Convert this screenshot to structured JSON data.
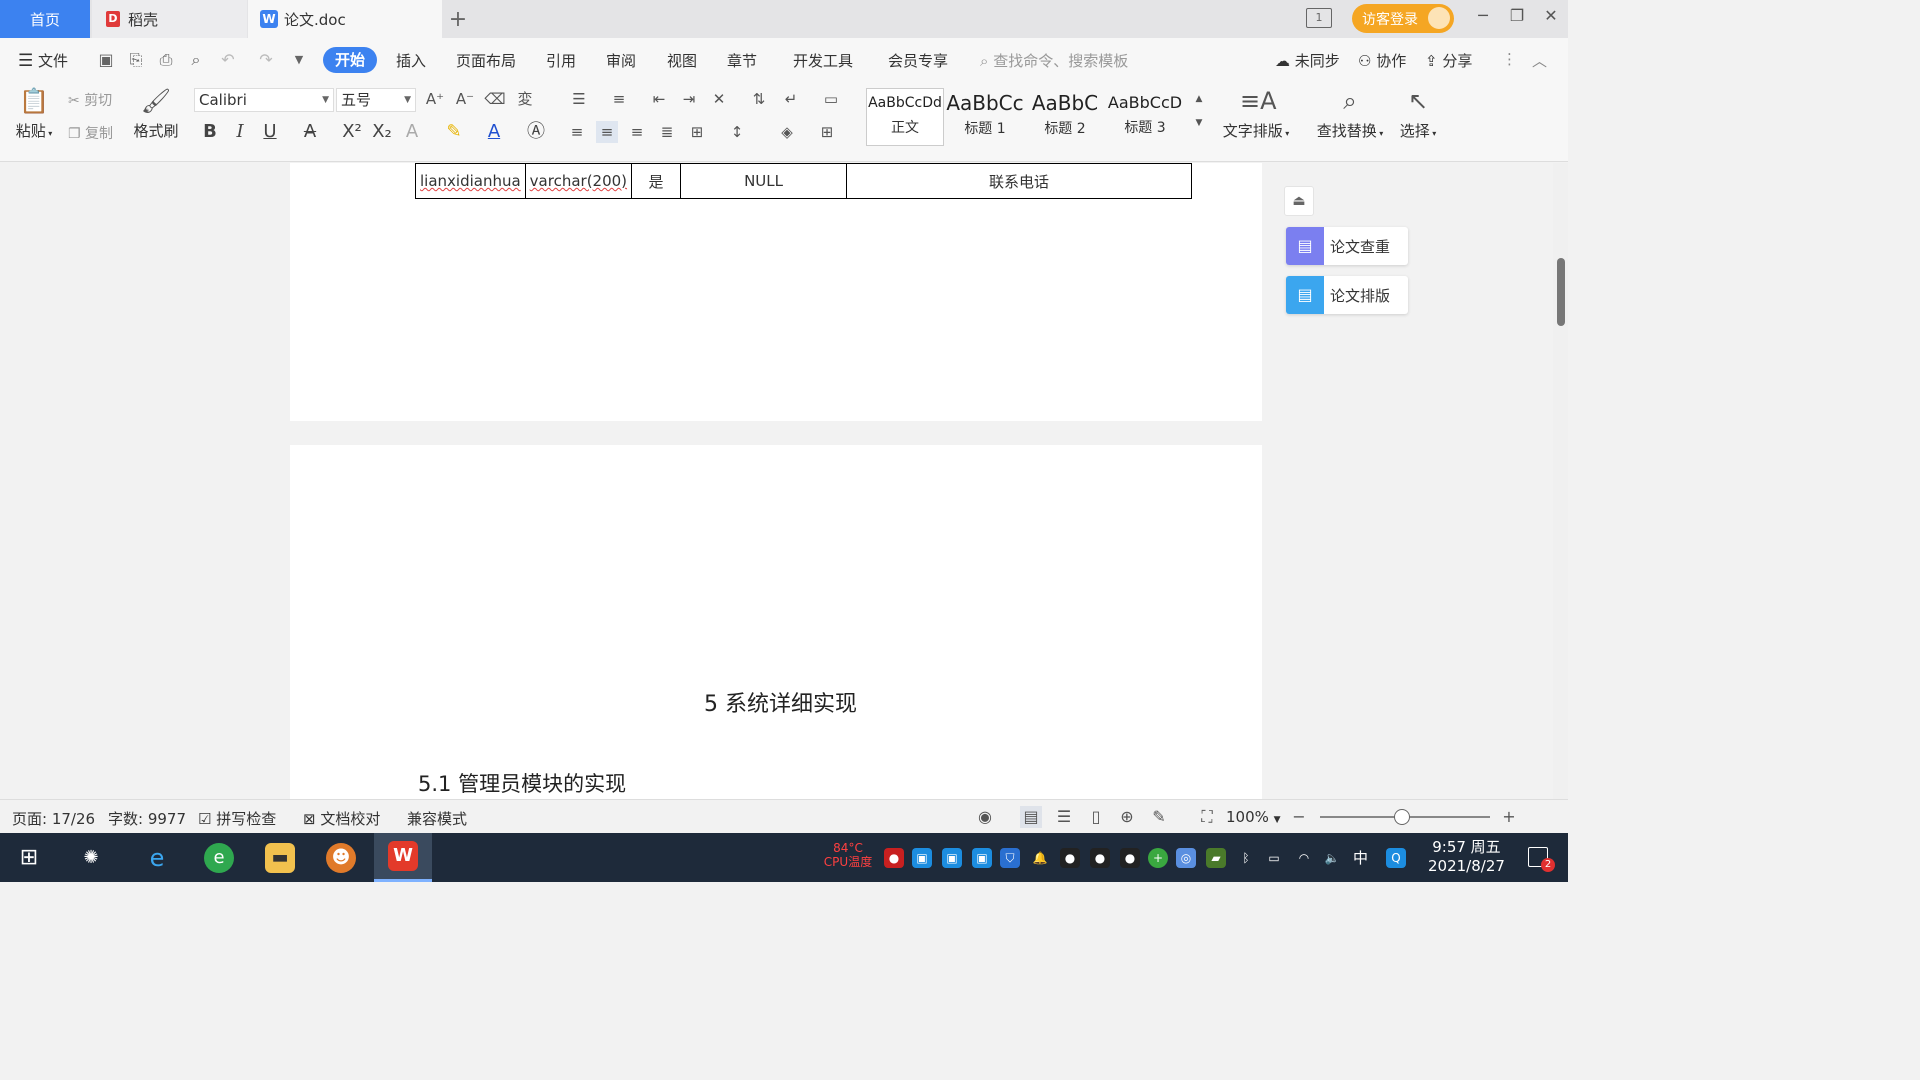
{
  "tabs": {
    "home": "首页",
    "daoke": "稻壳",
    "doc": "论文.doc",
    "new_tab": "+"
  },
  "window": {
    "visitor_login": "访客登录",
    "minimize": "─",
    "restore": "❐",
    "close": "✕"
  },
  "menu": {
    "file": "文件",
    "start": "开始",
    "insert": "插入",
    "layout": "页面布局",
    "references": "引用",
    "review": "审阅",
    "view": "视图",
    "chapter": "章节",
    "dev_tools": "开发工具",
    "member": "会员专享",
    "search_placeholder": "查找命令、搜索模板",
    "not_synced": "未同步",
    "collaborate": "协作",
    "share": "分享"
  },
  "ribbon": {
    "paste": "粘贴",
    "cut": "剪切",
    "copy": "复制",
    "format_painter": "格式刷",
    "font_name": "Calibri",
    "font_size": "五号",
    "styles": [
      {
        "sample": "AaBbCcDd",
        "label": "正文"
      },
      {
        "sample": "AaBbCc",
        "label": "标题 1"
      },
      {
        "sample": "AaBbC",
        "label": "标题 2"
      },
      {
        "sample": "AaBbCcD",
        "label": "标题 3"
      }
    ],
    "text_layout": "文字排版",
    "find_replace": "查找替换",
    "select": "选择"
  },
  "document": {
    "table_row": [
      "lianxidianhua",
      "varchar(200)",
      "是",
      "NULL",
      "联系电话"
    ],
    "section_title": "5 系统详细实现",
    "subsection_title": "5.1  管理员模块的实现"
  },
  "side_panel": {
    "check": "论文查重",
    "format": "论文排版"
  },
  "status": {
    "page": "页面: 17/26",
    "words": "字数: 9977",
    "spell_check": "拼写检查",
    "doc_proof": "文档校对",
    "compat_mode": "兼容模式",
    "zoom": "100%"
  },
  "taskbar": {
    "cpu_label_1": "84°C",
    "cpu_label_2": "CPU温度",
    "ime": "中",
    "time": "9:57 周五",
    "date": "2021/8/27",
    "notification_count": "2"
  },
  "colors": {
    "accent": "#3c82f0",
    "visitor": "#f5a623",
    "taskbar": "#1e2a3a"
  }
}
